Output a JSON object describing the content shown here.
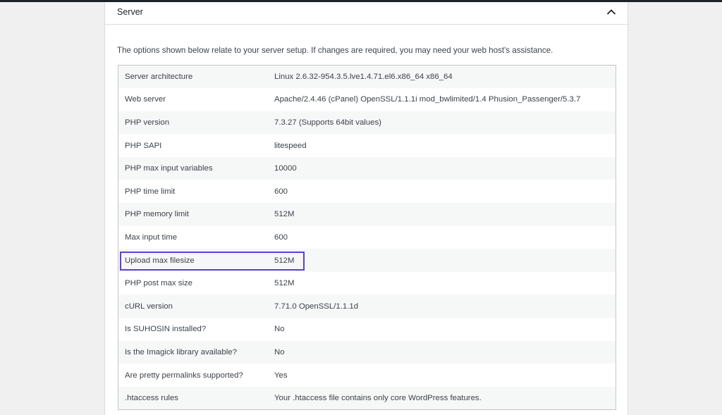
{
  "section": {
    "title": "Server",
    "toggle_icon": "chevron-up-icon",
    "description": "The options shown below relate to your server setup. If changes are required, you may need your web host's assistance."
  },
  "rows": [
    {
      "label": "Server architecture",
      "value": "Linux 2.6.32-954.3.5.lve1.4.71.el6.x86_64 x86_64"
    },
    {
      "label": "Web server",
      "value": "Apache/2.4.46 (cPanel) OpenSSL/1.1.1i mod_bwlimited/1.4 Phusion_Passenger/5.3.7"
    },
    {
      "label": "PHP version",
      "value": "7.3.27 (Supports 64bit values)"
    },
    {
      "label": "PHP SAPI",
      "value": "litespeed"
    },
    {
      "label": "PHP max input variables",
      "value": "10000"
    },
    {
      "label": "PHP time limit",
      "value": "600"
    },
    {
      "label": "PHP memory limit",
      "value": "512M"
    },
    {
      "label": "Max input time",
      "value": "600"
    },
    {
      "label": "Upload max filesize",
      "value": "512M"
    },
    {
      "label": "PHP post max size",
      "value": "512M"
    },
    {
      "label": "cURL version",
      "value": "7.71.0 OpenSSL/1.1.1d"
    },
    {
      "label": "Is SUHOSIN installed?",
      "value": "No"
    },
    {
      "label": "Is the Imagick library available?",
      "value": "No"
    },
    {
      "label": "Are pretty permalinks supported?",
      "value": "Yes"
    },
    {
      "label": ".htaccess rules",
      "value": "Your .htaccess file contains only core WordPress features."
    }
  ],
  "colors": {
    "highlight": "#5b3fe0",
    "page_background": "#f0f0f1",
    "row_alt": "#f6f7f7"
  }
}
